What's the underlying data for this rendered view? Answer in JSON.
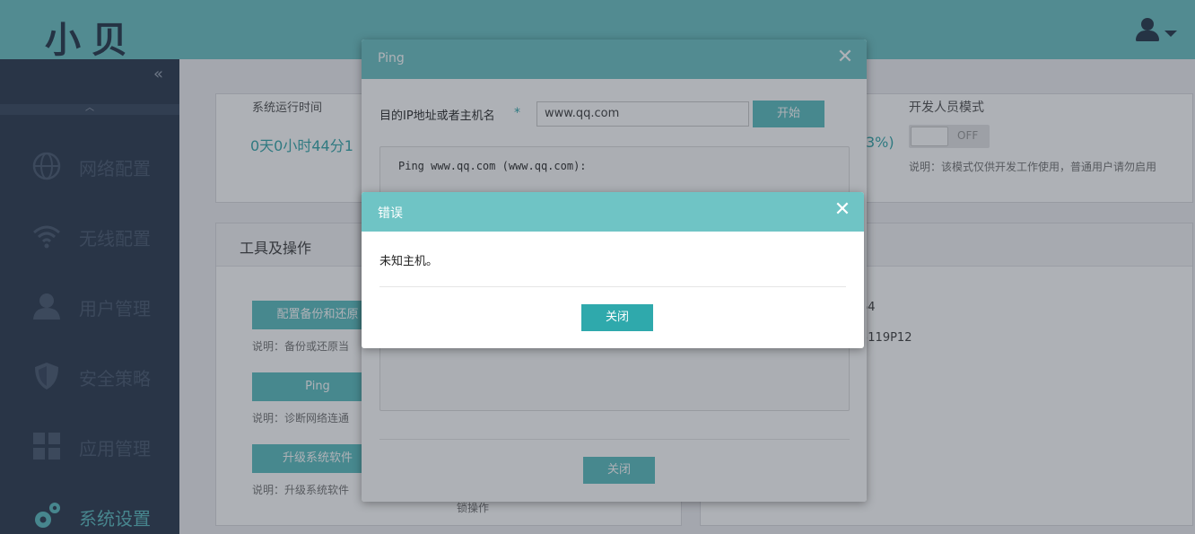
{
  "app": {
    "logo_text": "小贝"
  },
  "header": {
    "user_icon": "user-icon"
  },
  "sidebar": {
    "collapse_glyph": "«",
    "scroll_up_glyph": "︿",
    "items": [
      {
        "label": "网络配置",
        "icon": "globe-icon"
      },
      {
        "label": "无线配置",
        "icon": "wifi-icon"
      },
      {
        "label": "用户管理",
        "icon": "user-icon"
      },
      {
        "label": "安全策略",
        "icon": "shield-icon"
      },
      {
        "label": "应用管理",
        "icon": "grid-icon"
      },
      {
        "label": "系统设置",
        "icon": "gear-icon"
      }
    ]
  },
  "status": {
    "uptime_label": "系统运行时间",
    "uptime_value": "0天0小时44分1",
    "percent_partial": "3%)",
    "dev_mode_label": "开发人员模式",
    "dev_mode_toggle": "OFF",
    "dev_mode_note": "说明：该模式仅供开发工作使用，普通用户请勿启用"
  },
  "tools": {
    "title": "工具及操作",
    "backup_btn": "配置备份和还原",
    "backup_note": "说明：备份或还原当",
    "ping_btn": "Ping",
    "ping_note": "说明：诊断网络连通",
    "upgrade_btn": "升级系统软件",
    "upgrade_note": "说明：升级系统软件",
    "bottom_partial": "锁操作"
  },
  "info": {
    "val1": "64",
    "val2": "5119P12"
  },
  "ping_dialog": {
    "title": "Ping",
    "target_label": "目的IP地址或者主机名",
    "required_mark": "*",
    "target_value": "www.qq.com",
    "start_btn": "开始",
    "output": "Ping www.qq.com (www.qq.com):",
    "close_btn": "关闭"
  },
  "error_dialog": {
    "title": "错误",
    "message": "未知主机。",
    "close_btn": "关闭"
  },
  "colors": {
    "accent": "#6fc4c5",
    "button": "#5fbfc1",
    "primary_button": "#2fa9ac",
    "sidebar": "#2f3d52"
  }
}
